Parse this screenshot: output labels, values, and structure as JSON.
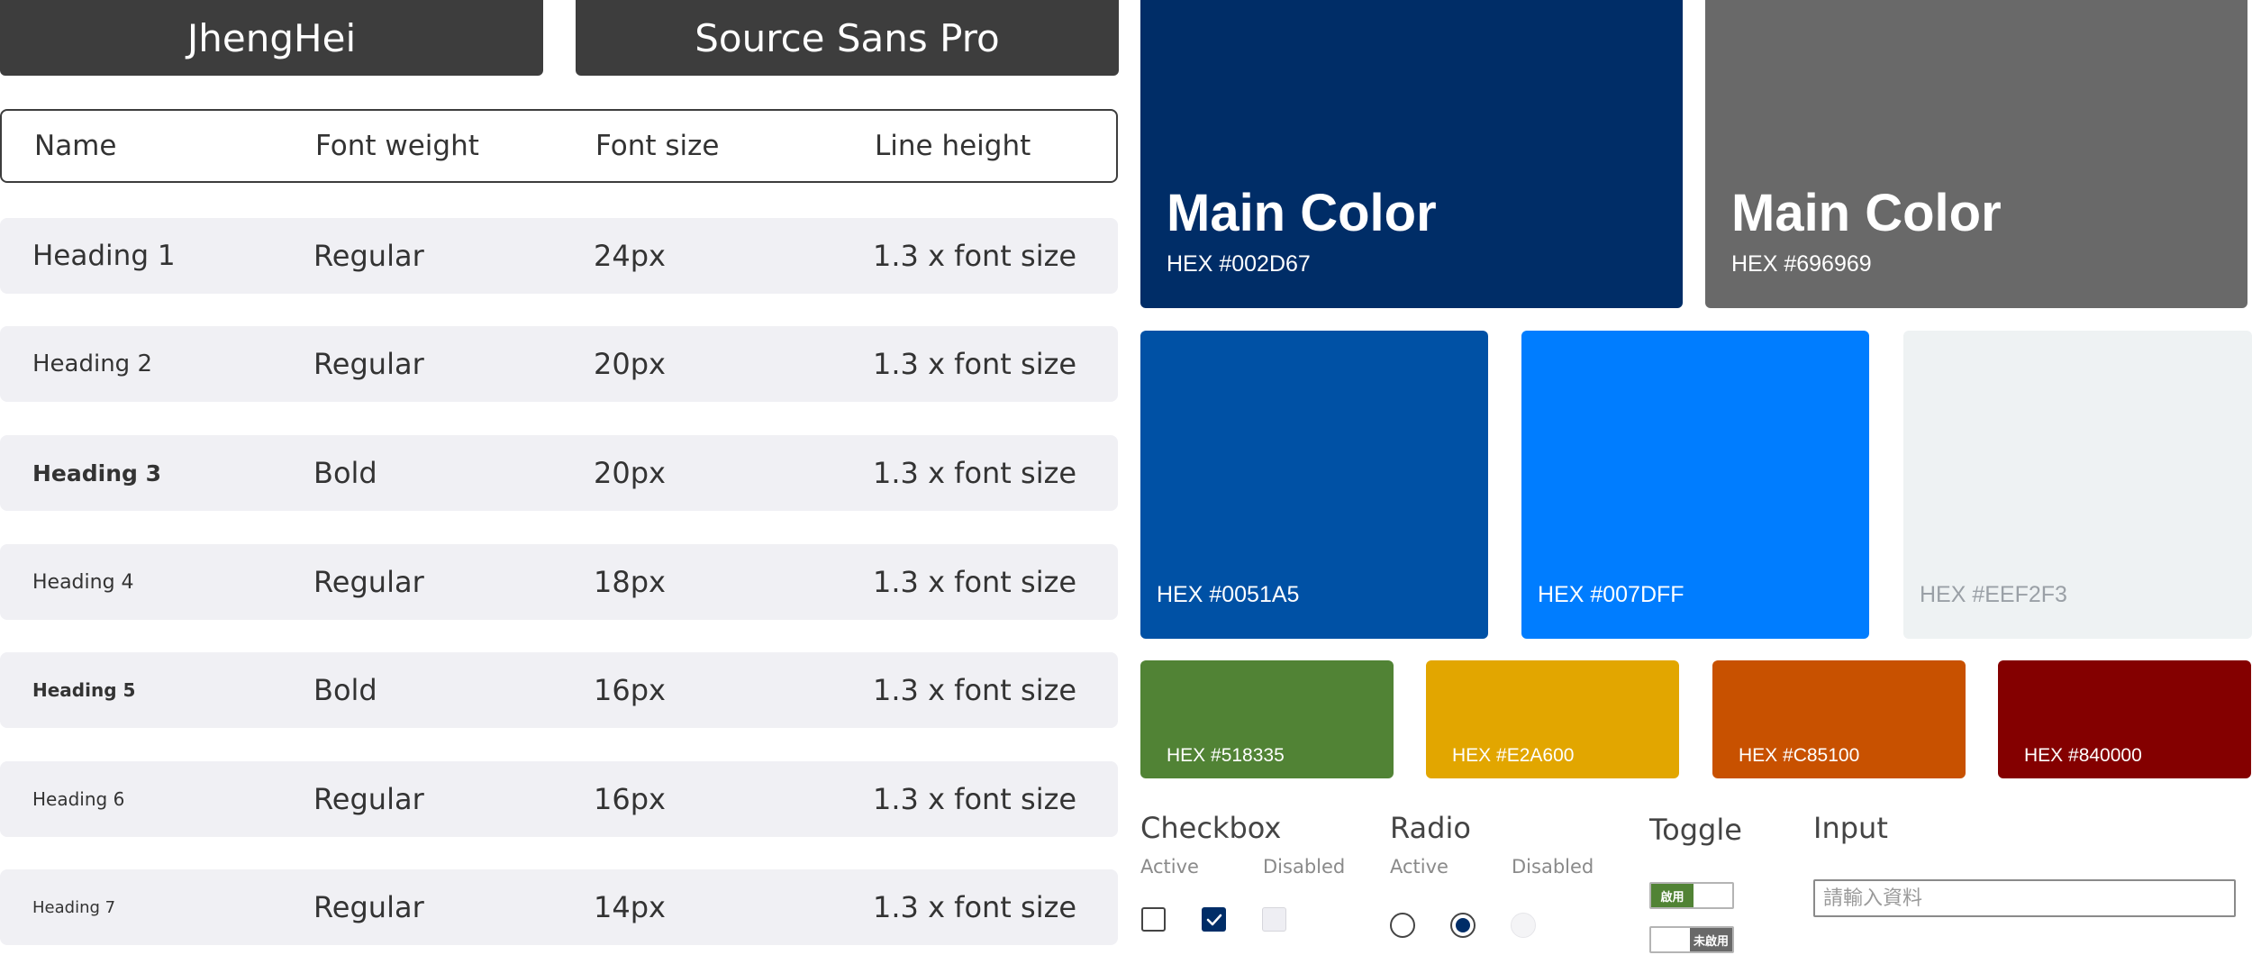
{
  "fonts": [
    "JhengHei",
    "Source Sans Pro"
  ],
  "table": {
    "headers": [
      "Name",
      "Font weight",
      "Font size",
      "Line height"
    ],
    "rows": [
      {
        "name": "Heading 1",
        "weight": "Regular",
        "size": "24px",
        "line_height": "1.3 x font size"
      },
      {
        "name": "Heading 2",
        "weight": "Regular",
        "size": "20px",
        "line_height": "1.3 x font size"
      },
      {
        "name": "Heading 3",
        "weight": "Bold",
        "size": "20px",
        "line_height": "1.3 x font size"
      },
      {
        "name": "Heading 4",
        "weight": "Regular",
        "size": "18px",
        "line_height": "1.3 x font size"
      },
      {
        "name": "Heading 5",
        "weight": "Bold",
        "size": "16px",
        "line_height": "1.3 x font size"
      },
      {
        "name": "Heading 6",
        "weight": "Regular",
        "size": "16px",
        "line_height": "1.3 x font size"
      },
      {
        "name": "Heading 7",
        "weight": "Regular",
        "size": "14px",
        "line_height": "1.3 x font size"
      }
    ]
  },
  "colors": {
    "main": [
      {
        "title": "Main Color",
        "hex_label": "HEX #002D67",
        "color": "#002D67"
      },
      {
        "title": "Main Color",
        "hex_label": "HEX #696969",
        "color": "#696969"
      }
    ],
    "secondary": [
      {
        "hex_label": "HEX #0051A5",
        "color": "#0051A5"
      },
      {
        "hex_label": "HEX #007DFF",
        "color": "#007DFF"
      },
      {
        "hex_label": "HEX #EEF2F3",
        "color": "#EEF2F3"
      }
    ],
    "status": [
      {
        "hex_label": "HEX #518335",
        "color": "#518335"
      },
      {
        "hex_label": "HEX #E2A600",
        "color": "#E2A600"
      },
      {
        "hex_label": "HEX #C85100",
        "color": "#C85100"
      },
      {
        "hex_label": "HEX #840000",
        "color": "#840000"
      }
    ]
  },
  "controls": {
    "checkbox": {
      "title": "Checkbox",
      "active": "Active",
      "disabled": "Disabled"
    },
    "radio": {
      "title": "Radio",
      "active": "Active",
      "disabled": "Disabled"
    },
    "toggle": {
      "title": "Toggle",
      "on_label": "啟用",
      "off_label": "未啟用"
    },
    "input": {
      "title": "Input",
      "placeholder": "請輸入資料"
    }
  }
}
